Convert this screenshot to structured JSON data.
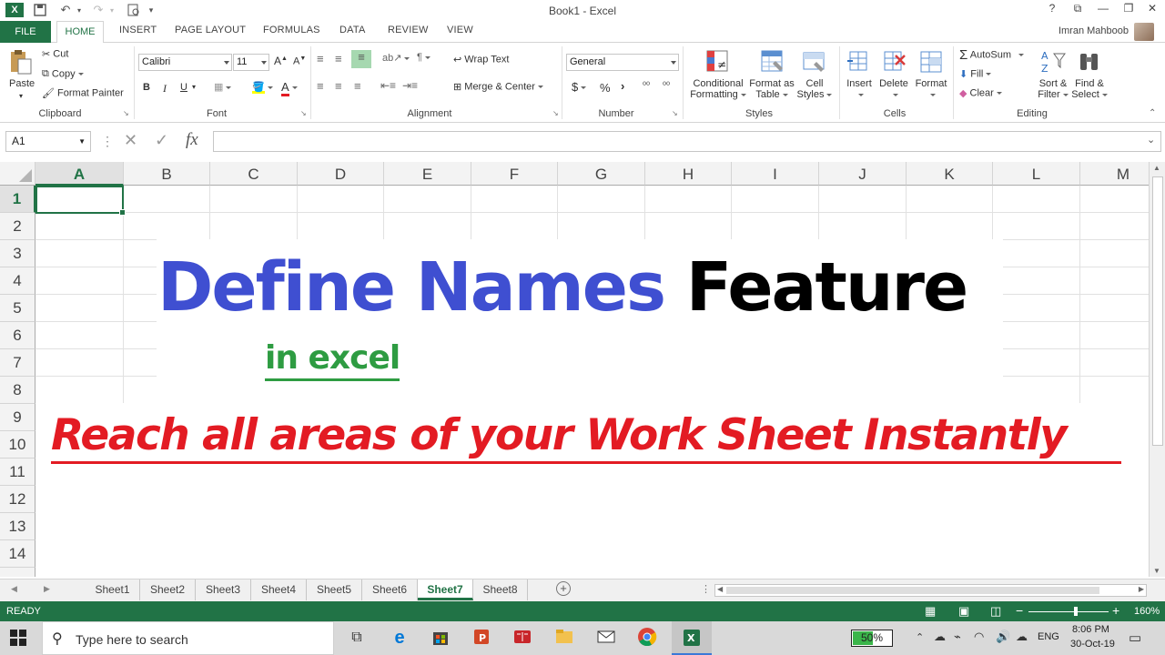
{
  "window": {
    "title": "Book1 - Excel"
  },
  "titlebar": {
    "help": "?",
    "restore": "⧉",
    "minimize": "—",
    "maximize": "❐",
    "close": "✕"
  },
  "user": {
    "name": "Imran Mahboob"
  },
  "tabs": [
    {
      "label": "FILE"
    },
    {
      "label": "HOME"
    },
    {
      "label": "INSERT"
    },
    {
      "label": "PAGE LAYOUT"
    },
    {
      "label": "FORMULAS"
    },
    {
      "label": "DATA"
    },
    {
      "label": "REVIEW"
    },
    {
      "label": "VIEW"
    }
  ],
  "ribbon": {
    "clipboard": {
      "paste": "Paste",
      "cut": "Cut",
      "copy": "Copy",
      "format_painter": "Format Painter",
      "label": "Clipboard"
    },
    "font": {
      "name": "Calibri",
      "size": "11",
      "bold": "B",
      "italic": "I",
      "underline": "U",
      "grow": "A",
      "shrink": "A",
      "font_color_glyph": "A",
      "label": "Font"
    },
    "alignment": {
      "wrap": "Wrap Text",
      "merge": "Merge & Center",
      "label": "Alignment"
    },
    "number": {
      "format": "General",
      "currency": "$",
      "percent": "%",
      "comma": "›",
      "inc_dec": "⁰⁰",
      "dec_dec": "⁰⁰",
      "label": "Number"
    },
    "styles": {
      "conditional1": "Conditional",
      "conditional2": "Formatting",
      "table1": "Format as",
      "table2": "Table",
      "cell1": "Cell",
      "cell2": "Styles",
      "label": "Styles"
    },
    "cells": {
      "insert": "Insert",
      "delete": "Delete",
      "format": "Format",
      "label": "Cells"
    },
    "editing": {
      "autosum": "AutoSum",
      "fill": "Fill",
      "clear": "Clear",
      "sort1": "Sort &",
      "sort2": "Filter",
      "find1": "Find &",
      "find2": "Select",
      "label": "Editing"
    }
  },
  "formula_bar": {
    "name_box": "A1",
    "fx": "fx",
    "value": ""
  },
  "columns": [
    "A",
    "B",
    "C",
    "D",
    "E",
    "F",
    "G",
    "H",
    "I",
    "J",
    "K",
    "L",
    "M"
  ],
  "rows": [
    "1",
    "2",
    "3",
    "4",
    "5",
    "6",
    "7",
    "8",
    "9",
    "10",
    "11",
    "12",
    "13",
    "14"
  ],
  "overlay": {
    "title_blue": "Define Names",
    "title_black": "Feature",
    "subtitle": "in excel",
    "tagline": "Reach all areas of your Work Sheet Instantly"
  },
  "sheets": [
    "Sheet1",
    "Sheet2",
    "Sheet3",
    "Sheet4",
    "Sheet5",
    "Sheet6",
    "Sheet7",
    "Sheet8"
  ],
  "active_sheet": "Sheet7",
  "statusbar": {
    "mode": "READY",
    "zoom": "160%"
  },
  "taskbar": {
    "search_placeholder": "Type here to search",
    "battery": "50%",
    "lang": "ENG",
    "time": "8:06 PM",
    "date": "30-Oct-19"
  },
  "colors": {
    "excel_green": "#217346",
    "title_blue": "#3f4fd1",
    "subtitle_green": "#2e9c42",
    "tagline_red": "#e31b23"
  }
}
